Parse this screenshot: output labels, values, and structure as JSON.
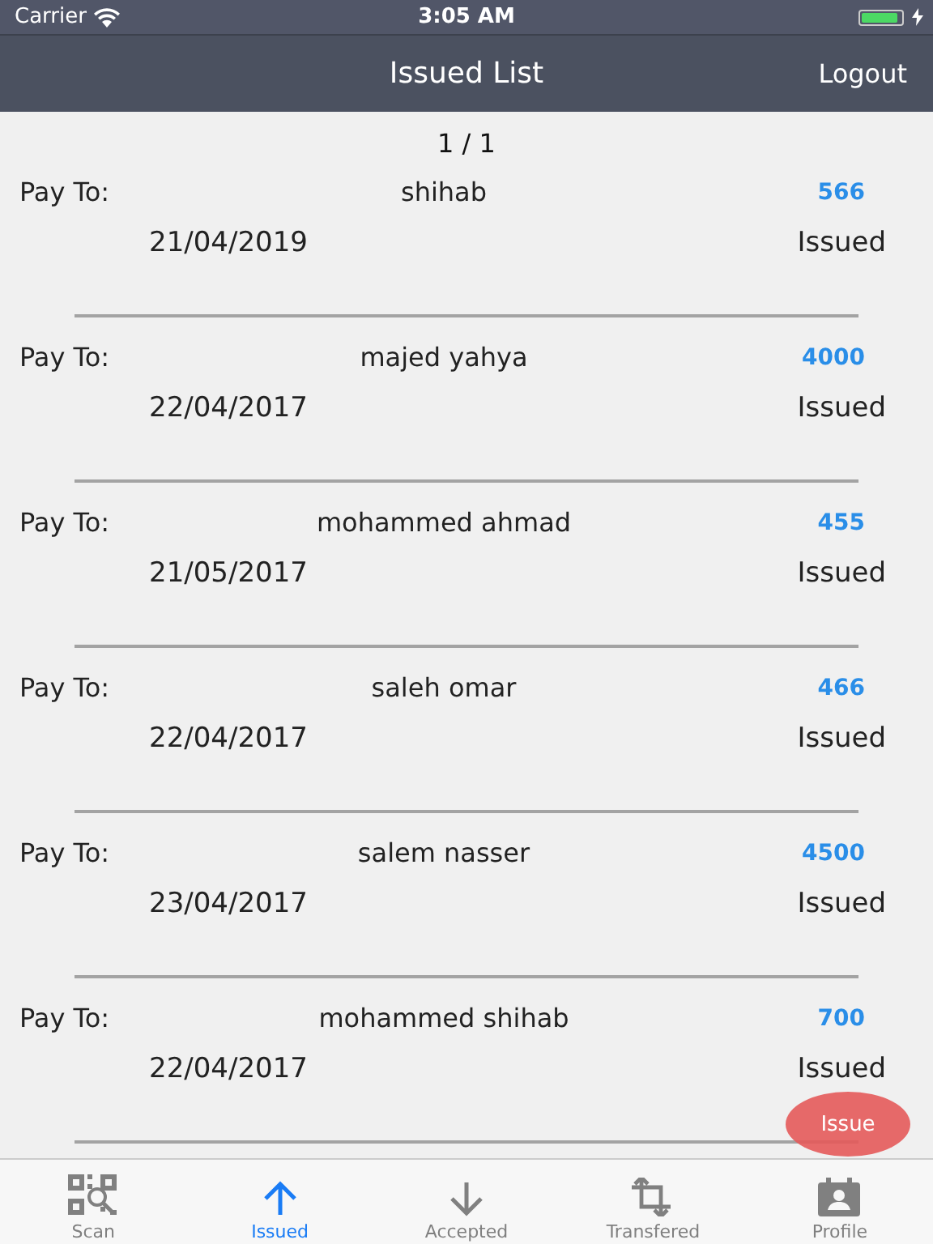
{
  "status_bar": {
    "carrier": "Carrier",
    "time": "3:05 AM",
    "battery": {
      "level": 0.9,
      "charging": true
    }
  },
  "nav": {
    "title": "Issued List",
    "action": "Logout"
  },
  "page": "1 / 1",
  "rows": [
    {
      "label": "Pay To:",
      "name": "shihab",
      "amount": "566",
      "date": "21/04/2019",
      "status": "Issued"
    },
    {
      "label": "Pay To:",
      "name": "majed yahya",
      "amount": "4000",
      "date": "22/04/2017",
      "status": "Issued"
    },
    {
      "label": "Pay To:",
      "name": "mohammed ahmad",
      "amount": "455",
      "date": "21/05/2017",
      "status": "Issued"
    },
    {
      "label": "Pay To:",
      "name": "saleh omar",
      "amount": "466",
      "date": "22/04/2017",
      "status": "Issued"
    },
    {
      "label": "Pay To:",
      "name": "salem nasser",
      "amount": "4500",
      "date": "23/04/2017",
      "status": "Issued"
    },
    {
      "label": "Pay To:",
      "name": "mohammed shihab",
      "amount": "700",
      "date": "22/04/2017",
      "status": "Issued"
    }
  ],
  "fab": "Issue",
  "tabs": [
    {
      "label": "Scan",
      "kind": "scan",
      "selected": false
    },
    {
      "label": "Issued",
      "kind": "up",
      "selected": true
    },
    {
      "label": "Accepted",
      "kind": "down",
      "selected": false
    },
    {
      "label": "Transfered",
      "kind": "crop",
      "selected": false
    },
    {
      "label": "Profile",
      "kind": "profile",
      "selected": false
    }
  ]
}
